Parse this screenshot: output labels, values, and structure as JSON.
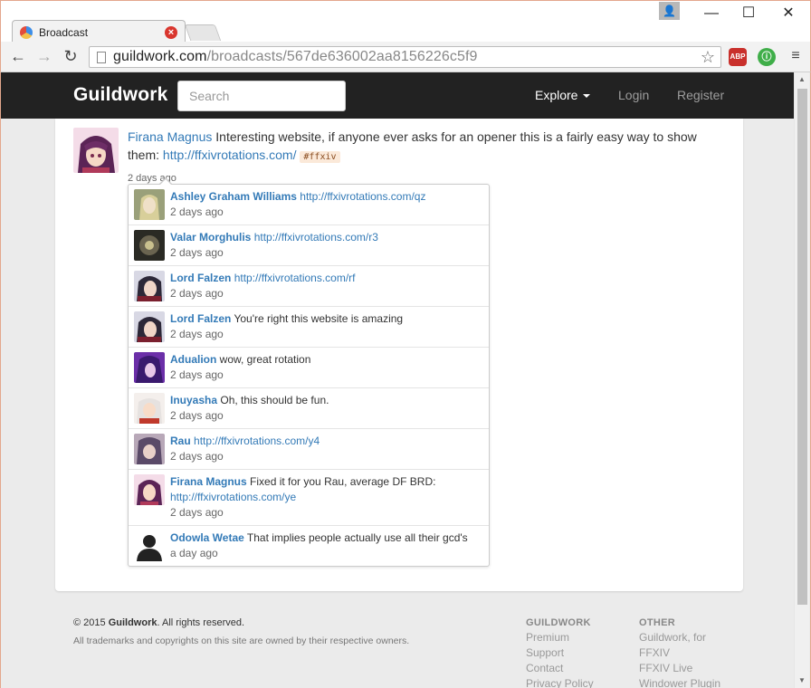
{
  "browser": {
    "tab_title": "Broadcast",
    "url_host": "guildwork.com",
    "url_path": "/broadcasts/567de636002aa8156226c5f9",
    "ext_abp": "ABP"
  },
  "site": {
    "brand": "Guildwork",
    "search_placeholder": "Search",
    "nav": {
      "explore": "Explore",
      "login": "Login",
      "register": "Register"
    }
  },
  "post": {
    "author": "Firana Magnus",
    "text_before": " Interesting website, if anyone ever asks for an opener this is a fairly easy way to show them: ",
    "link": "http://ffxivrotations.com/",
    "hashtag": "#ffxiv",
    "time": "2 days ago"
  },
  "replies": [
    {
      "author": "Ashley Graham Williams",
      "text": "http://ffxivrotations.com/qz",
      "is_link": true,
      "time": "2 days ago"
    },
    {
      "author": "Valar Morghulis",
      "text": "http://ffxivrotations.com/r3",
      "is_link": true,
      "time": "2 days ago"
    },
    {
      "author": "Lord Falzen",
      "text": "http://ffxivrotations.com/rf",
      "is_link": true,
      "time": "2 days ago"
    },
    {
      "author": "Lord Falzen",
      "text": "You're right this website is amazing",
      "is_link": false,
      "time": "2 days ago"
    },
    {
      "author": "Adualion",
      "text": "wow, great rotation",
      "is_link": false,
      "time": "2 days ago"
    },
    {
      "author": "Inuyasha",
      "text": "Oh, this should be fun.",
      "is_link": false,
      "time": "2 days ago"
    },
    {
      "author": "Rau",
      "text": "http://ffxivrotations.com/y4",
      "is_link": true,
      "time": "2 days ago"
    },
    {
      "author": "Firana Magnus",
      "text": "Fixed it for you Rau, average DF BRD:",
      "link": "http://ffxivrotations.com/ye",
      "is_link": false,
      "time": "2 days ago"
    },
    {
      "author": "Odowla Wetae",
      "text": "That implies people actually use all their gcd's",
      "is_link": false,
      "time": "a day ago"
    }
  ],
  "footer": {
    "copyright_prefix": "© 2015 ",
    "copyright_brand": "Guildwork",
    "copyright_suffix": ". All rights reserved.",
    "trademark": "All trademarks and copyrights on this site are owned by their respective owners.",
    "col1": {
      "heading": "GUILDWORK",
      "links": [
        "Premium",
        "Support",
        "Contact",
        "Privacy Policy"
      ]
    },
    "col2": {
      "heading": "OTHER",
      "links": [
        "Guildwork, for",
        "FFXIV",
        "FFXIV Live",
        "Windower Plugin"
      ]
    }
  },
  "colors": {
    "link": "#337ab7",
    "navbar": "#222222",
    "hashtag_bg": "#fbe9d9"
  }
}
